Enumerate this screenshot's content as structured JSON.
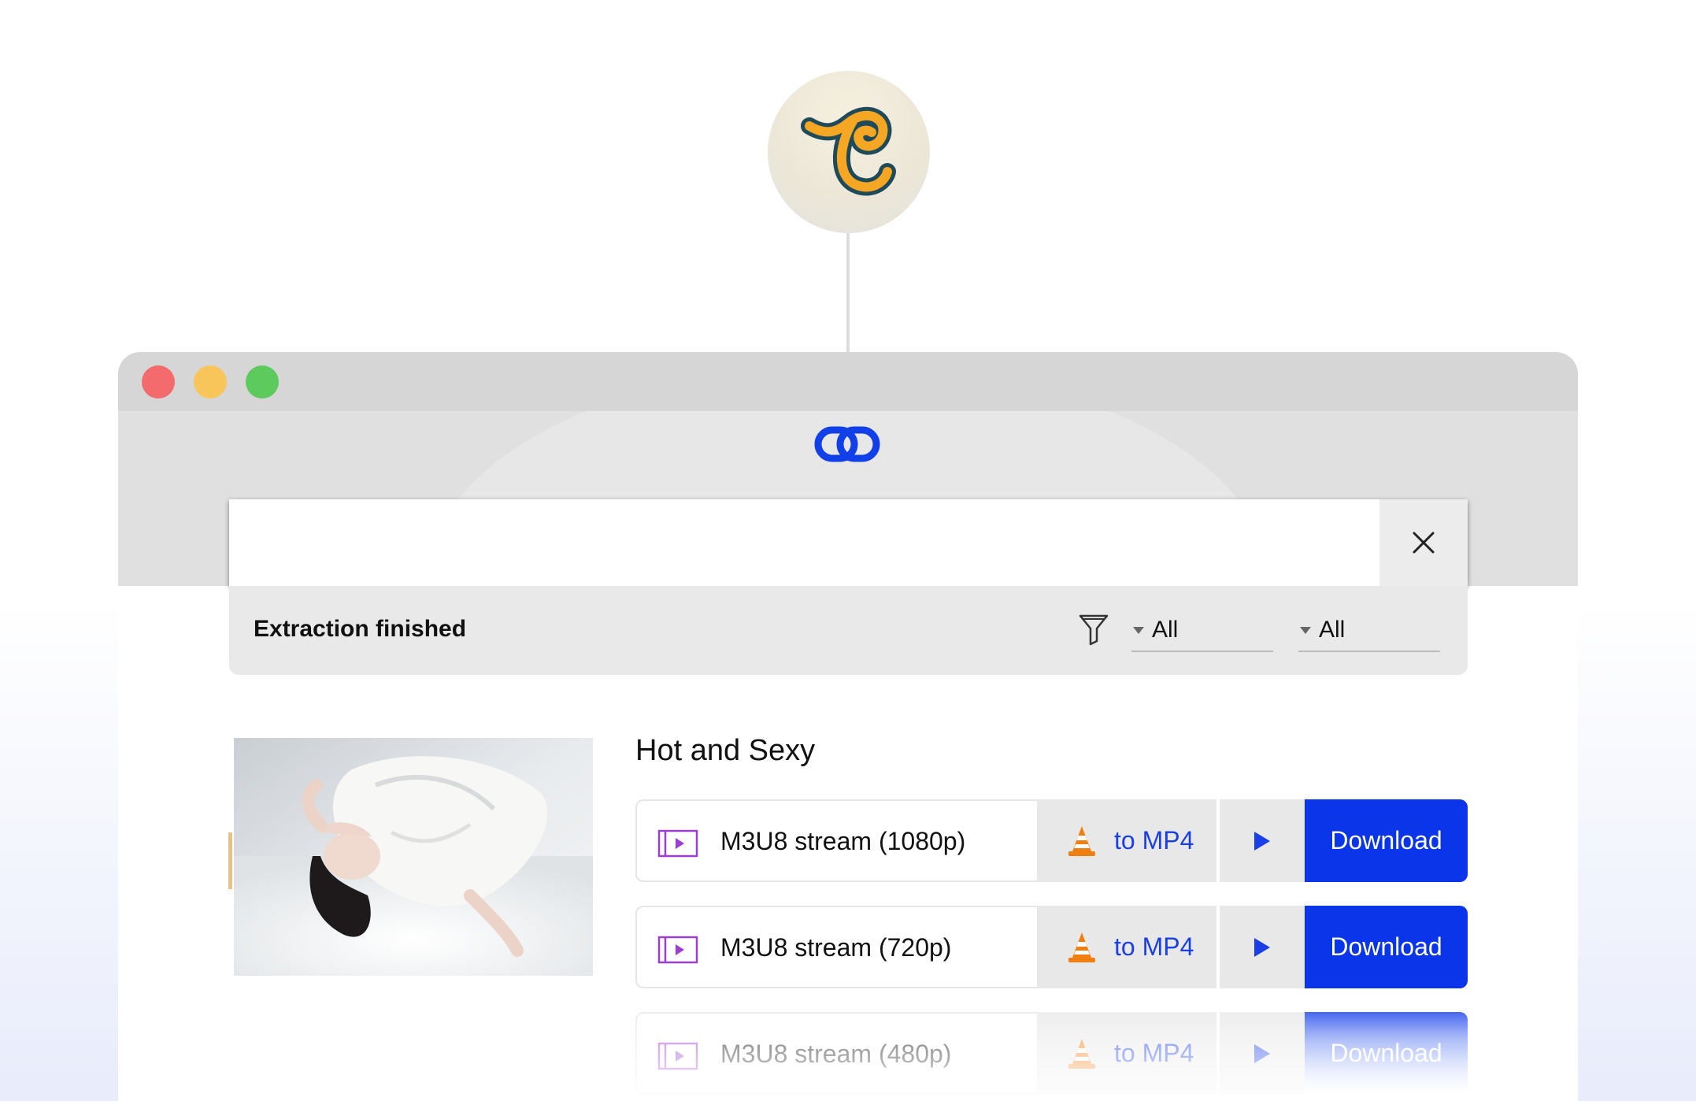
{
  "search": {
    "value": "",
    "placeholder": ""
  },
  "status": {
    "text": "Extraction finished",
    "filter_type": "All",
    "filter_quality": "All"
  },
  "result": {
    "title": "Hot and Sexy",
    "streams": [
      {
        "label": "M3U8 stream (1080p)",
        "convert_label": "to MP4",
        "download_label": "Download"
      },
      {
        "label": "M3U8 stream (720p)",
        "convert_label": "to MP4",
        "download_label": "Download"
      },
      {
        "label": "M3U8 stream (480p)",
        "convert_label": "to MP4",
        "download_label": "Download"
      }
    ]
  },
  "icons": [
    "app-logo-icon",
    "link-logo-icon",
    "close-icon",
    "filter-icon",
    "video-file-icon",
    "vlc-cone-icon",
    "play-icon"
  ],
  "colors": {
    "accent": "#0a35e8",
    "link_text": "#1a3fe6",
    "close_red": "#f36b6c",
    "minimize_yellow": "#f8c55a",
    "maximize_green": "#5cca5c"
  }
}
